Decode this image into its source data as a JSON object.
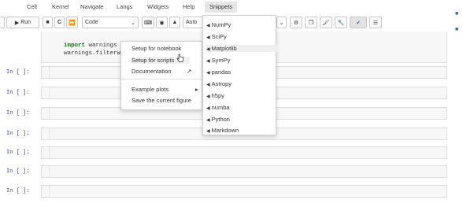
{
  "menubar": {
    "items": [
      "Cell",
      "Kernel",
      "Navigate",
      "Langs",
      "Widgets",
      "Help",
      "Snippets"
    ]
  },
  "toolbar": {
    "run_label": "Run",
    "cell_type": "Code",
    "auto_label": "Auto"
  },
  "code": {
    "line1_keyword": "import",
    "line1_rest": " warnings",
    "line2": "warnings.filterwar"
  },
  "cells": {
    "prompt": "In [ ]:"
  },
  "submenu": {
    "items": [
      "Setup for notebook",
      "Setup for scripts",
      "Documentation",
      "Example plots",
      "Save the current figure"
    ]
  },
  "snippets_menu": {
    "items": [
      "NumPy",
      "SciPy",
      "Matplotlib",
      "SymPy",
      "pandas",
      "Astropy",
      "h5py",
      "numba",
      "Python",
      "Markdown"
    ]
  },
  "colors": {
    "accent": "#2a6eb7",
    "prompt": "#303f9f",
    "keyword": "#008000"
  }
}
